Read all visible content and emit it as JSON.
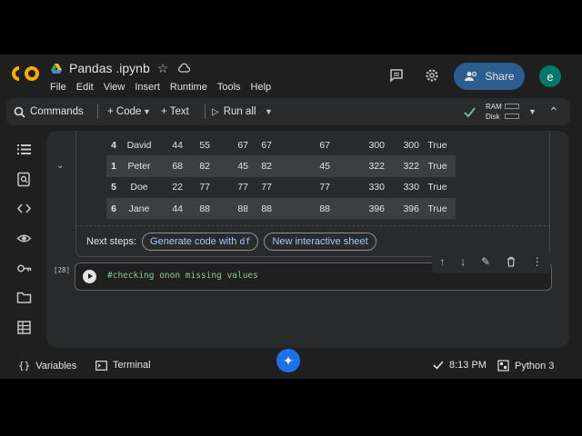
{
  "header": {
    "title": "Pandas .ipynb",
    "menu": [
      "File",
      "Edit",
      "View",
      "Insert",
      "Runtime",
      "Tools",
      "Help"
    ],
    "share_label": "Share",
    "avatar_letter": "e"
  },
  "toolbar": {
    "commands_label": "Commands",
    "code_label": "+ Code",
    "text_label": "+ Text",
    "run_all_label": "Run all",
    "ram_label": "RAM",
    "disk_label": "Disk"
  },
  "output": {
    "rows": [
      {
        "idx": "4",
        "name": "David",
        "c1": "44",
        "c2": "55",
        "c3": "67",
        "c4": "67",
        "c5": "67",
        "c6": "300",
        "c7": "300",
        "c8": "True",
        "alt": false
      },
      {
        "idx": "1",
        "name": "Peter",
        "c1": "68",
        "c2": "82",
        "c3": "45",
        "c4": "82",
        "c5": "45",
        "c6": "322",
        "c7": "322",
        "c8": "True",
        "alt": true
      },
      {
        "idx": "5",
        "name": "Doe",
        "c1": "22",
        "c2": "77",
        "c3": "77",
        "c4": "77",
        "c5": "77",
        "c6": "330",
        "c7": "330",
        "c8": "True",
        "alt": false
      },
      {
        "idx": "6",
        "name": "Jane",
        "c1": "44",
        "c2": "88",
        "c3": "88",
        "c4": "88",
        "c5": "88",
        "c6": "396",
        "c7": "396",
        "c8": "True",
        "alt": true
      }
    ],
    "next_steps_label": "Next steps:",
    "generate_chip": "Generate code with",
    "generate_chip_code": "df",
    "sheet_chip": "New interactive sheet"
  },
  "cell": {
    "exec_count": "[28]",
    "code": "#checking onon missing values"
  },
  "status": {
    "variables_label": "Variables",
    "terminal_label": "Terminal",
    "time": "8:13 PM",
    "kernel": "Python 3"
  },
  "colors": {
    "accent": "#a8c7fa",
    "share_bg": "#2b5d8e",
    "logo_orange": "#f9ab00",
    "check_green": "#81c995"
  }
}
